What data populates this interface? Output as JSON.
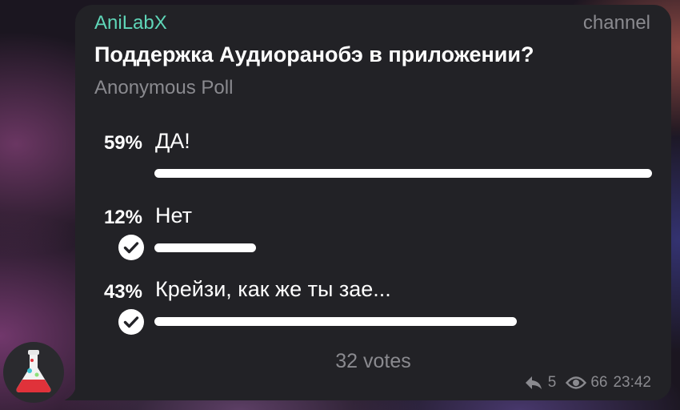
{
  "post": {
    "channel_name": "AniLabX",
    "channel_tag": "channel",
    "avatar_icon": "flask-icon",
    "accent_color": "#5fd6b8"
  },
  "poll": {
    "question": "Поддержка Аудиоранобэ в приложении?",
    "type": "Anonymous Poll",
    "options": [
      {
        "percent": "59%",
        "value": 59,
        "text": "ДА!",
        "chosen": false
      },
      {
        "percent": "12%",
        "value": 12,
        "text": "Нет",
        "chosen": true
      },
      {
        "percent": "43%",
        "value": 43,
        "text": "Крейзи, как же ты зае...",
        "chosen": true
      }
    ],
    "votes": "32 votes"
  },
  "footer": {
    "shares": "5",
    "views": "66",
    "time": "23:42",
    "share_icon": "share-arrow-icon",
    "views_icon": "eye-icon"
  }
}
